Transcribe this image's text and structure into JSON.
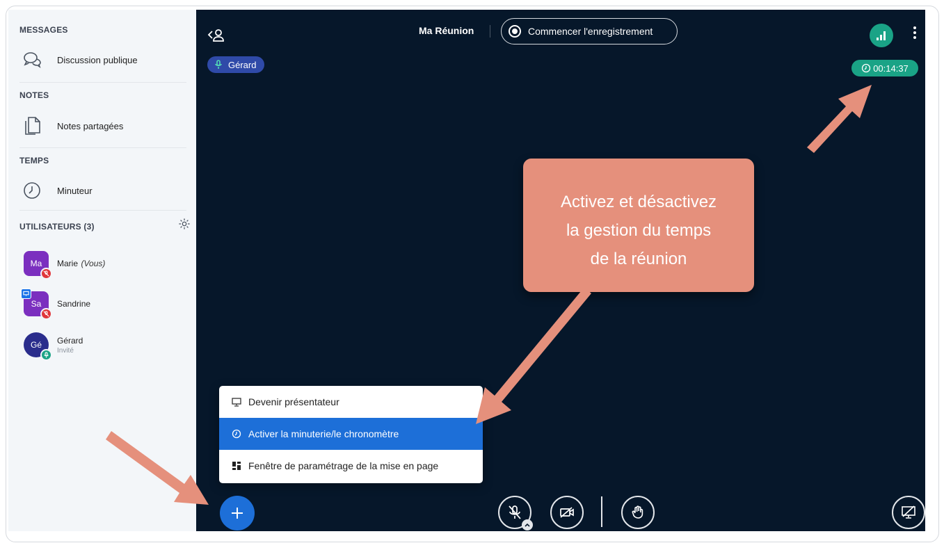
{
  "sidebar": {
    "messages_title": "MESSAGES",
    "public_chat": "Discussion publique",
    "notes_title": "NOTES",
    "shared_notes": "Notes partagées",
    "time_title": "TEMPS",
    "timer_item": "Minuteur",
    "users_title": "UTILISATEURS (3)",
    "users": [
      {
        "initials": "Ma",
        "name": "Marie",
        "suffix": "(Vous)",
        "role": "",
        "color": "#7b2fbf"
      },
      {
        "initials": "Sa",
        "name": "Sandrine",
        "suffix": "",
        "role": "",
        "color": "#7b2fbf"
      },
      {
        "initials": "Gé",
        "name": "Gérard",
        "suffix": "",
        "role": "Invité",
        "color": "#2a2d8c"
      }
    ]
  },
  "topbar": {
    "meeting_title": "Ma Réunion",
    "record_label": "Commencer l'enregistrement",
    "timer_value": "00:14:37",
    "talker": "Gérard"
  },
  "callout": {
    "line1": "Activez et désactivez",
    "line2": "la gestion du temps",
    "line3": "de la réunion"
  },
  "menu": {
    "items": [
      {
        "label": "Devenir présentateur"
      },
      {
        "label": "Activer la minuterie/le chronomètre"
      },
      {
        "label": "Fenêtre de paramétrage de la mise en page"
      }
    ]
  },
  "colors": {
    "accent": "#1d6fd8",
    "success": "#1aa386",
    "main_bg": "#06172a",
    "callout": "#e5907c",
    "muted_badge": "#e0363b"
  }
}
